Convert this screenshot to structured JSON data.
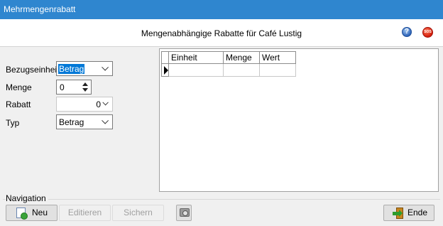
{
  "window": {
    "title": "Mehrmengenrabatt"
  },
  "header": {
    "title": "Mengenabhängige Rabatte für Café Lustig",
    "help_icon": "help-icon",
    "sos_icon": "sos-icon"
  },
  "form": {
    "bezugseinheit": {
      "label": "Bezugseinheit",
      "value": "Betrag"
    },
    "menge": {
      "label": "Menge",
      "value": "0"
    },
    "rabatt": {
      "label": "Rabatt",
      "value": "0"
    },
    "typ": {
      "label": "Typ",
      "value": "Betrag"
    }
  },
  "grid": {
    "columns": [
      "Einheit",
      "Menge",
      "Wert"
    ],
    "rows": [
      [
        "",
        "",
        ""
      ]
    ]
  },
  "navigation": {
    "label": "Navigation",
    "buttons": {
      "neu": "Neu",
      "editieren": "Editieren",
      "sichern": "Sichern",
      "ende": "Ende"
    }
  }
}
